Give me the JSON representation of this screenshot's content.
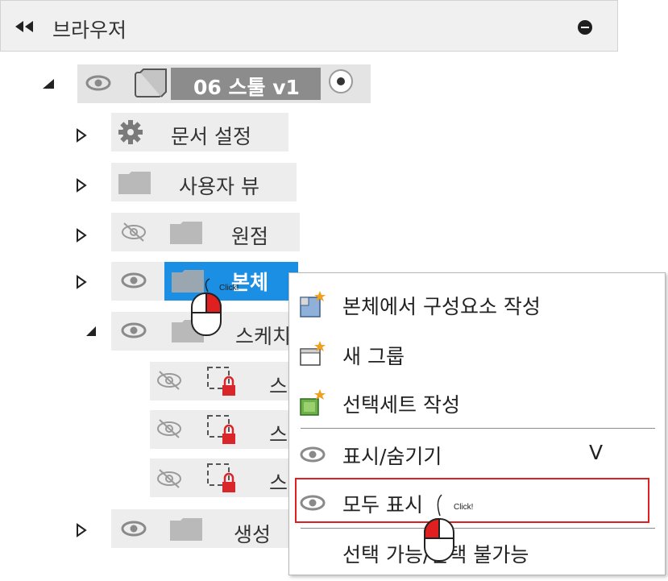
{
  "header": {
    "title": "브라우저"
  },
  "tree": {
    "root": {
      "label": "06 스툴 v1"
    },
    "doc_settings": {
      "label": "문서 설정"
    },
    "named_views": {
      "label": "사용자 뷰"
    },
    "origin": {
      "label": "원점"
    },
    "bodies": {
      "label": "본체"
    },
    "sketches": {
      "label": "스케치"
    },
    "sketch_items": [
      {
        "label": "스"
      },
      {
        "label": "스"
      },
      {
        "label": "스"
      }
    ],
    "construction": {
      "label": "생성"
    }
  },
  "context_menu": {
    "items": [
      {
        "label": "본체에서 구성요소 작성",
        "icon": "component-icon"
      },
      {
        "label": "새 그룹",
        "icon": "new-group-icon"
      },
      {
        "label": "선택세트 작성",
        "icon": "selection-set-icon"
      },
      {
        "label": "표시/숨기기",
        "shortcut": "V",
        "icon": "eye-icon"
      },
      {
        "label": "모두 표시",
        "icon": "eye-icon"
      },
      {
        "label": "선택 가능/선택 불가능"
      }
    ]
  },
  "annotations": {
    "click1": "Click!",
    "click2": "Click!"
  },
  "colors": {
    "selection": "#1a8fe3",
    "highlight_border": "#e02020",
    "folder": "#b9b9b9"
  }
}
